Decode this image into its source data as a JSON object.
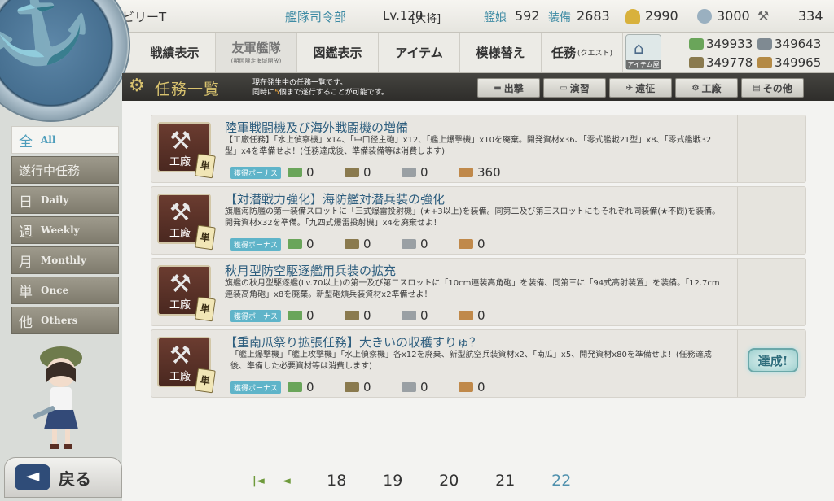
{
  "header": {
    "player_name": "ビリーT",
    "hq_label": "艦隊司令部",
    "hq_level": "Lv.120",
    "hq_rank": "[大将]",
    "ship_label": "艦娘",
    "ship_count": "592",
    "equip_label": "装備",
    "equip_count": "2683",
    "fuel": "2990",
    "bauxite": "3000",
    "hammer": "334"
  },
  "materials": {
    "instant_repair": "349933",
    "development": "349643",
    "ammo": "349778",
    "steel": "349965"
  },
  "nav": {
    "record": "戦績表示",
    "friend_fleet": "友軍艦隊",
    "friend_fleet_sub": "(期間限定海域開放)",
    "encyclopedia": "図鑑表示",
    "items": "アイテム",
    "furniture": "模様替え",
    "quest": "任務",
    "quest_sub": "(クエスト)",
    "shop": "アイテム屋"
  },
  "titlebar": {
    "title": "任務一覧",
    "note_line1": "現在発生中の任務一覧です。",
    "note_line2_a": "同時に",
    "note_line2_num": "5",
    "note_line2_b": "個まで遂行することが可能です。"
  },
  "filters": [
    "出撃",
    "演習",
    "遠征",
    "工廠",
    "その他"
  ],
  "categories": [
    {
      "ja": "全",
      "en": "All"
    },
    {
      "ja": "遂行中任務",
      "en": ""
    },
    {
      "ja": "日",
      "en": "Daily"
    },
    {
      "ja": "週",
      "en": "Weekly"
    },
    {
      "ja": "月",
      "en": "Monthly"
    },
    {
      "ja": "単",
      "en": "Once"
    },
    {
      "ja": "他",
      "en": "Others"
    }
  ],
  "quests": [
    {
      "category": "工廠",
      "badge": "単",
      "title": "陸軍戦闘機及び海外戦闘機の増備",
      "desc": "【工廠任務】「水上偵察機」x14、「中口径主砲」x12、「艦上爆撃機」x10を廃棄。開発資材x36、「零式艦戦21型」x8、「零式艦戦32型」x4を準備せよ！(任務達成後、準備装備等は消費します)",
      "bonus_label": "獲得ボーナス",
      "rewards": [
        "0",
        "0",
        "0",
        "360"
      ],
      "status": ""
    },
    {
      "category": "工廠",
      "badge": "単",
      "title": "【対潜戦力強化】海防艦対潜兵装の強化",
      "desc": "旗艦海防艦の第一装備スロットに「三式爆雷投射機」(★+3以上)を装備。同第二及び第三スロットにもそれぞれ同装備(★不問)を装備。開発資材x32を準備。「九四式爆雷投射機」x4を廃棄せよ！",
      "bonus_label": "獲得ボーナス",
      "rewards": [
        "0",
        "0",
        "0",
        "0"
      ],
      "status": ""
    },
    {
      "category": "工廠",
      "badge": "単",
      "title": "秋月型防空駆逐艦用兵装の拡充",
      "desc": "旗艦の秋月型駆逐艦(Lv.70以上)の第一及び第二スロットに「10cm連装高角砲」を装備、同第三に「94式高射装置」を装備。「12.7cm連装高角砲」x8を廃棄。新型砲熕兵装資材x2準備せよ！",
      "bonus_label": "獲得ボーナス",
      "rewards": [
        "0",
        "0",
        "0",
        "0"
      ],
      "status": ""
    },
    {
      "category": "工廠",
      "badge": "単",
      "title": "【重南瓜祭り拡張任務】大きいの収穫すりゅ？",
      "desc": "「艦上爆撃機」「艦上攻撃機」「水上偵察機」各x12を廃棄、新型航空兵装資材x2、「南瓜」x5、開発資材x80を準備せよ！(任務達成後、準備した必要資材等は消費します)",
      "bonus_label": "獲得ボーナス",
      "rewards": [
        "0",
        "0",
        "0",
        "0"
      ],
      "status": "達成!"
    }
  ],
  "back_label": "戻る",
  "pagination": {
    "first": "|◄",
    "prev": "◄",
    "pages": [
      "18",
      "19",
      "20",
      "21",
      "22"
    ],
    "current": "22"
  },
  "colors": {
    "accent_blue": "#4f90ad",
    "gold": "#d9c36f",
    "bonus_teal": "#5fb4c9",
    "fuel": "#d8b13c",
    "ammo": "#8a7a4e",
    "steel": "#9aa0a4",
    "bauxite": "#c0894a"
  }
}
